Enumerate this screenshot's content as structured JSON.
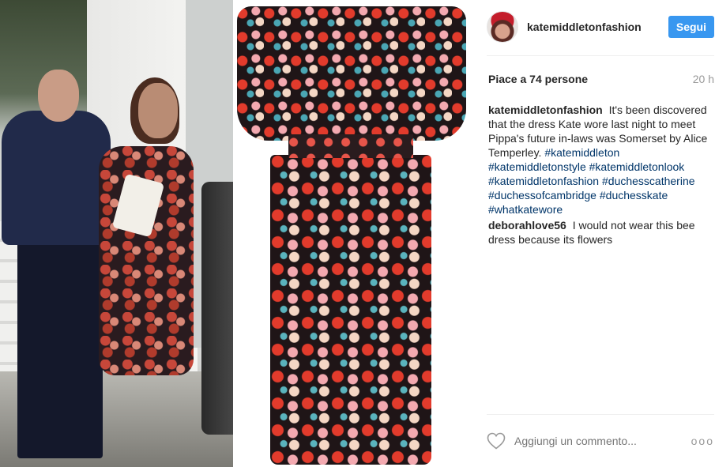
{
  "post": {
    "username": "katemiddletonfashion",
    "follow_label": "Segui",
    "likes_text": "Piace a 74 persone",
    "time_ago": "20 h"
  },
  "comments": [
    {
      "user": "katemiddletonfashion",
      "text": "It's been discovered that the dress Kate wore last night to meet Pippa's future in-laws was Somerset by Alice Temperley.",
      "hashtags": [
        "#katemiddleton",
        "#katemiddletonstyle",
        "#katemiddletonlook",
        "#katemiddletonfashion",
        "#duchesscatherine",
        "#duchessofcambridge",
        "#duchesskate",
        "#whatkatewore"
      ]
    },
    {
      "user": "deborahlove56",
      "text": "I would not wear this bee dress because its flowers"
    }
  ],
  "composer": {
    "placeholder": "Aggiungi un commento...",
    "more_label": "ooo"
  },
  "colors": {
    "accent": "#3897f0",
    "hashtag": "#003569",
    "muted": "#999999"
  },
  "icons": [
    "heart-icon",
    "more-options-icon"
  ]
}
